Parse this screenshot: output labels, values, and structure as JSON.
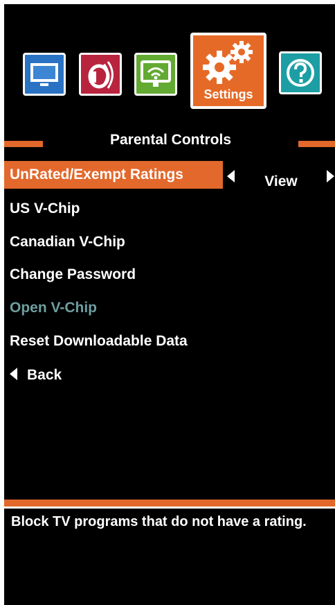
{
  "topbar": {
    "icons": [
      {
        "name": "tv-icon",
        "color": "#2a73c4"
      },
      {
        "name": "audio-icon",
        "color": "#b8243e"
      },
      {
        "name": "network-icon",
        "color": "#63aa32"
      },
      {
        "name": "settings-icon",
        "color": "#e56a27"
      },
      {
        "name": "help-icon",
        "color": "#1d9ea4"
      }
    ],
    "settings_label": "Settings"
  },
  "heading": "Parental Controls",
  "menu": {
    "items": [
      {
        "label": "UnRated/Exempt Ratings",
        "selected": true
      },
      {
        "label": "US V-Chip"
      },
      {
        "label": "Canadian V-Chip"
      },
      {
        "label": "Change Password"
      },
      {
        "label": "Open V-Chip",
        "disabled": true
      },
      {
        "label": "Reset Downloadable Data"
      },
      {
        "label": "Back"
      }
    ],
    "selected_value": "View"
  },
  "help": {
    "text": "Block TV programs that do not have a rating."
  },
  "colors": {
    "accent": "#e2682b",
    "background": "#000000",
    "disabled_text": "#6f9ea0"
  }
}
